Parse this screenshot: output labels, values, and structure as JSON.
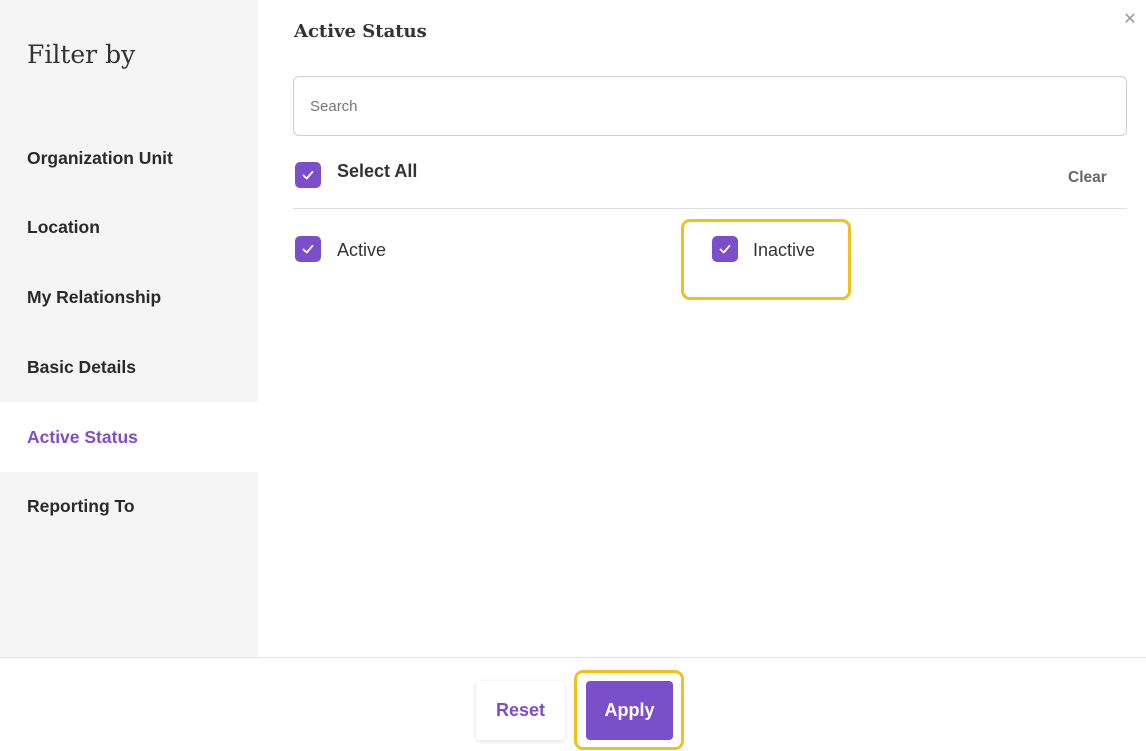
{
  "sidebar": {
    "title": "Filter by",
    "items": [
      {
        "label": "Organization Unit"
      },
      {
        "label": "Location"
      },
      {
        "label": "My Relationship"
      },
      {
        "label": "Basic Details"
      },
      {
        "label": "Active Status",
        "active": true
      },
      {
        "label": "Reporting To"
      }
    ]
  },
  "panel": {
    "title": "Active Status",
    "search_placeholder": "Search",
    "select_all_label": "Select All",
    "select_all_checked": true,
    "clear_label": "Clear",
    "options": [
      {
        "label": "Active",
        "checked": true
      },
      {
        "label": "Inactive",
        "checked": true
      }
    ]
  },
  "footer": {
    "reset_label": "Reset",
    "apply_label": "Apply"
  },
  "colors": {
    "accent": "#7b4fc9",
    "highlight": "#f2c01e",
    "sidebar_bg": "#f5f5f5"
  },
  "icons": {
    "close": "close-icon",
    "check": "check-icon"
  }
}
